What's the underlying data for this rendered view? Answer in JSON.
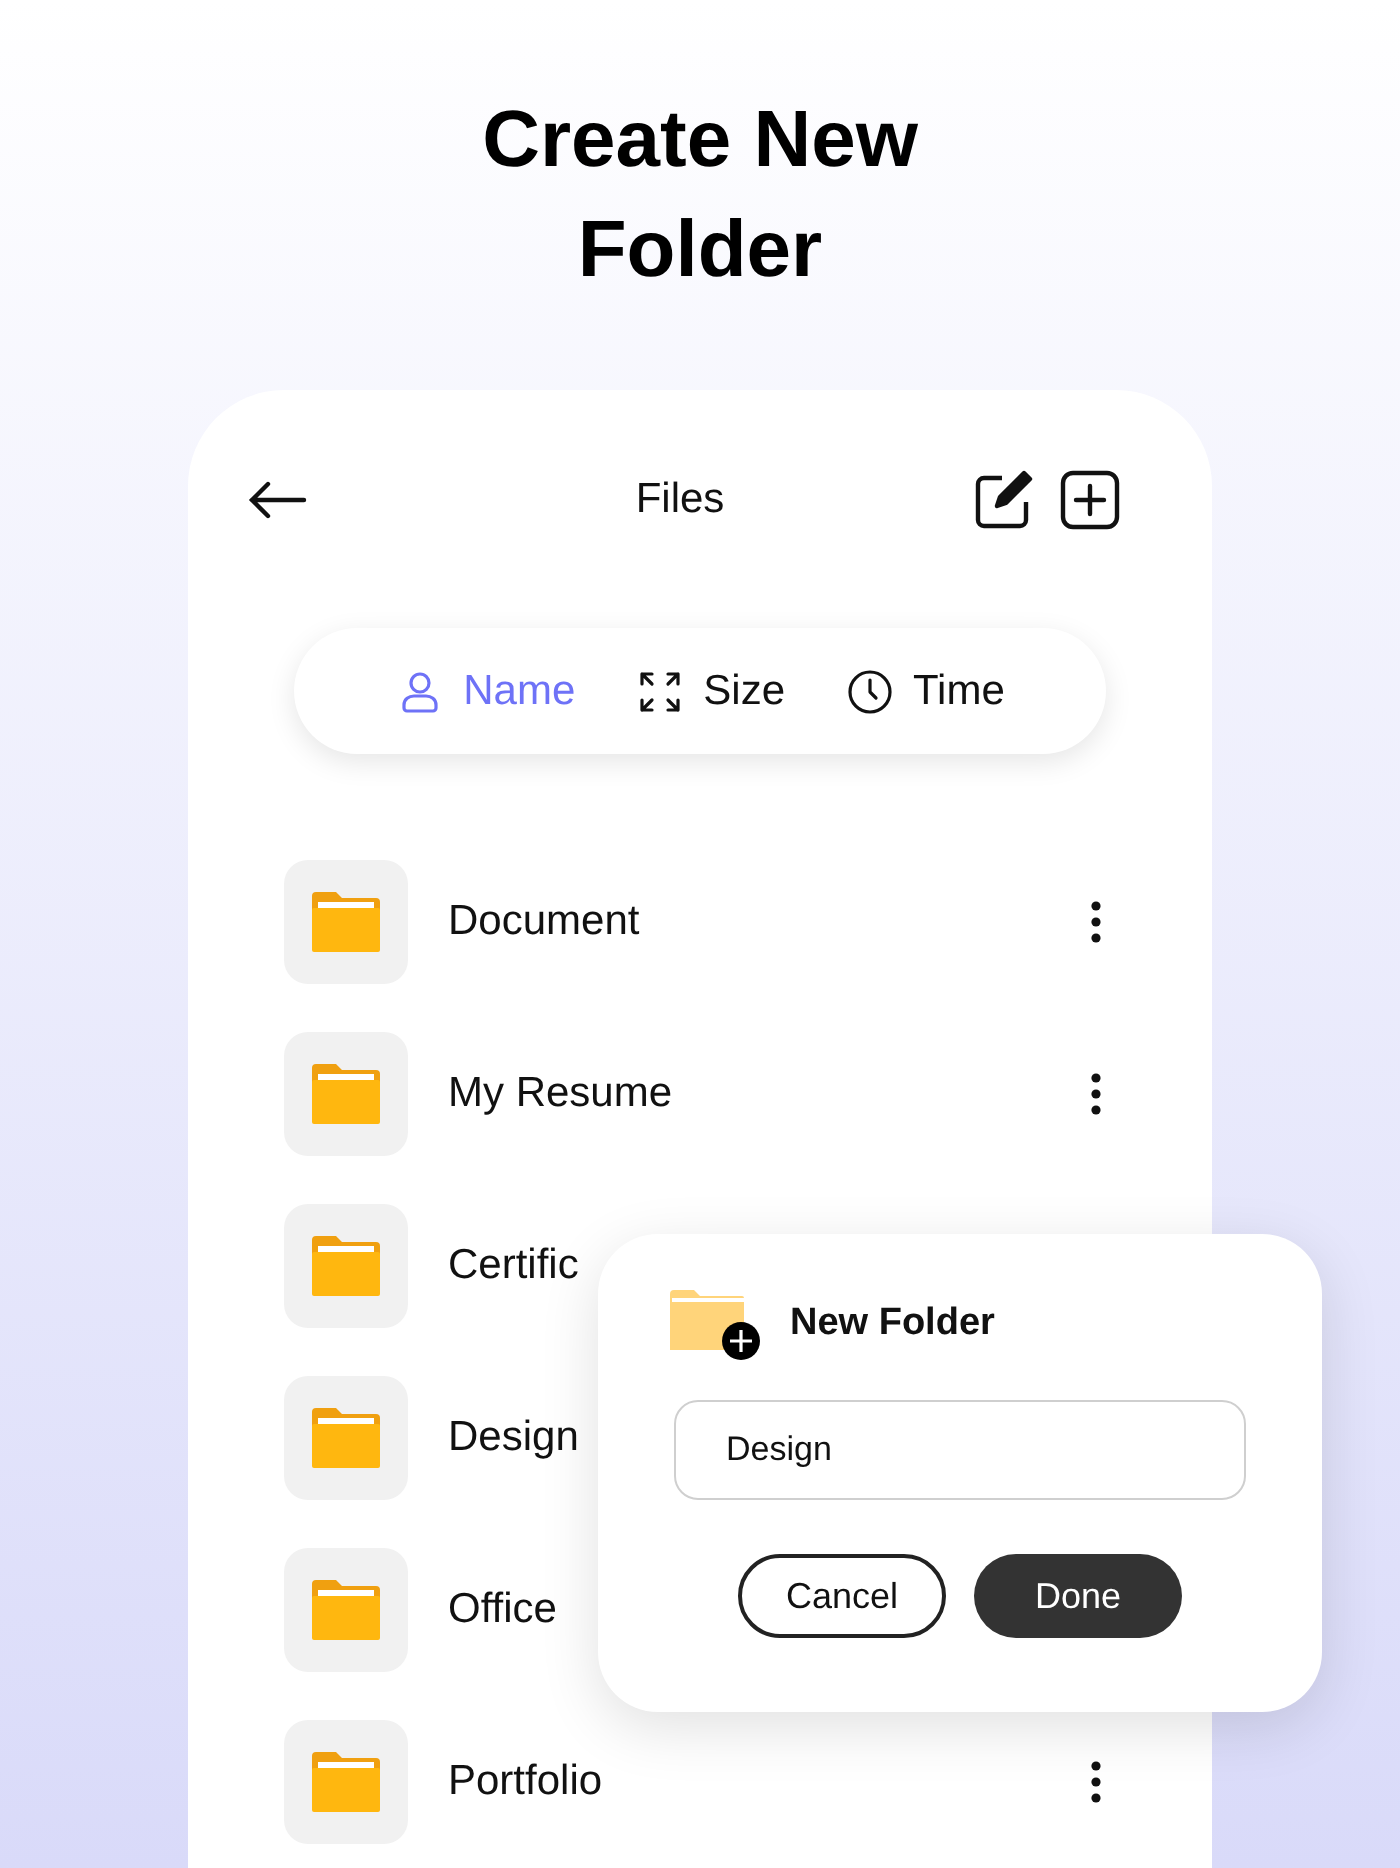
{
  "headline": "Create New Folder",
  "screen": {
    "title": "Files"
  },
  "sort_tabs": [
    {
      "label": "Name",
      "kind": "person",
      "selected": true
    },
    {
      "label": "Size",
      "kind": "expand",
      "selected": false
    },
    {
      "label": "Time",
      "kind": "clock",
      "selected": false
    }
  ],
  "files": [
    {
      "name": "Document",
      "menu": true
    },
    {
      "name": "My Resume",
      "menu": true
    },
    {
      "name": "Certific",
      "menu": false
    },
    {
      "name": "Design",
      "menu": false
    },
    {
      "name": "Office",
      "menu": false
    },
    {
      "name": "Portfolio",
      "menu": true
    }
  ],
  "dialog": {
    "title": "New Folder",
    "value": "Design",
    "buttons": [
      {
        "label": "Cancel",
        "kind": "secondary"
      },
      {
        "label": "Done",
        "kind": "primary"
      }
    ]
  }
}
